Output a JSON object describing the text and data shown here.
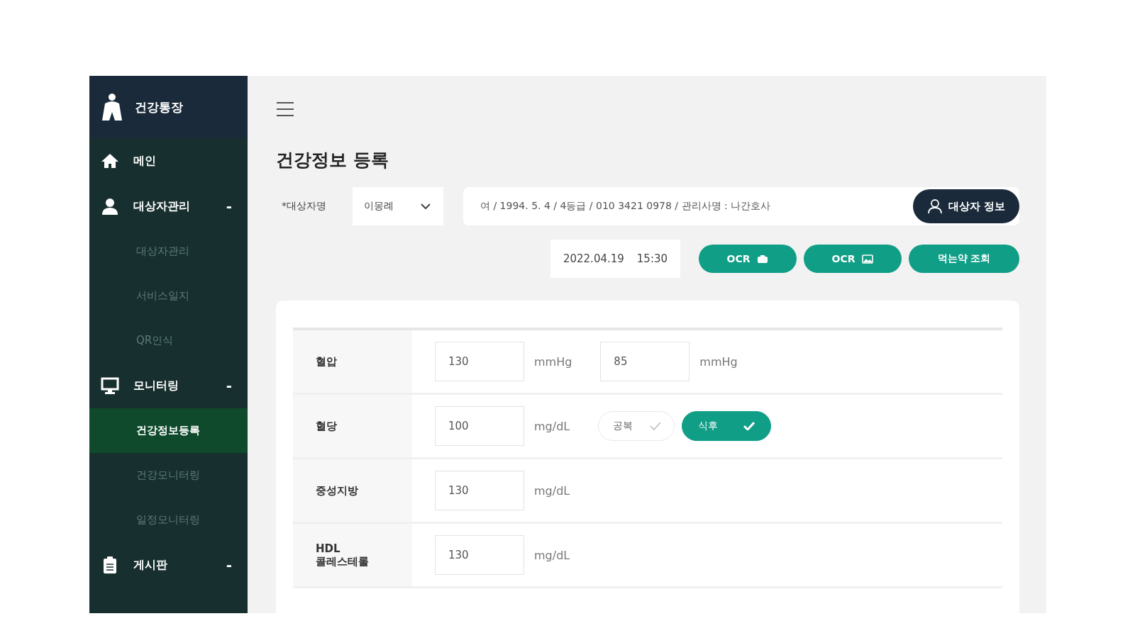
{
  "sidebar": {
    "logo": "건강통장",
    "items": [
      {
        "label": "메인"
      },
      {
        "label": "대상자관리",
        "expanded": true,
        "toggle": "-",
        "children": [
          {
            "label": "대상자관리",
            "selected": false
          },
          {
            "label": "서비스일지",
            "selected": false
          },
          {
            "label": "QR인식",
            "selected": false
          }
        ]
      },
      {
        "label": "모니터링",
        "expanded": true,
        "toggle": "-",
        "children": [
          {
            "label": "건강정보등록",
            "selected": true
          },
          {
            "label": "건강모니터링",
            "selected": false
          },
          {
            "label": "일정모니터링",
            "selected": false
          }
        ]
      },
      {
        "label": "게시판",
        "expanded": true,
        "toggle": "-"
      }
    ]
  },
  "page_title": "건강정보 등록",
  "subject": {
    "label": "*대상자명",
    "value": "이몽례",
    "info": "여 / 1994. 5. 4 / 4등급 / 010 3421 0978 / 관리사명 : 나간호사",
    "info_button": "대상자 정보"
  },
  "datetime": {
    "date": "2022.04.19",
    "time": "15:30"
  },
  "actions": [
    {
      "label": "OCR"
    },
    {
      "label": "OCR"
    },
    {
      "label": "먹는약 조회"
    }
  ],
  "rows": [
    {
      "label": "혈압",
      "inputs": [
        {
          "value": "130",
          "unit": "mmHg"
        },
        {
          "value": "85",
          "unit": "mmHg"
        }
      ]
    },
    {
      "label": "혈당",
      "inputs": [
        {
          "value": "100",
          "unit": "mg/dL"
        }
      ],
      "toggles": [
        {
          "label": "공복",
          "selected": false
        },
        {
          "label": "식후",
          "selected": true
        }
      ]
    },
    {
      "label": "중성지방",
      "inputs": [
        {
          "value": "130",
          "unit": "mg/dL"
        }
      ]
    },
    {
      "label": "HDL\n콜레스테롤",
      "inputs": [
        {
          "value": "130",
          "unit": "mg/dL"
        }
      ]
    }
  ]
}
